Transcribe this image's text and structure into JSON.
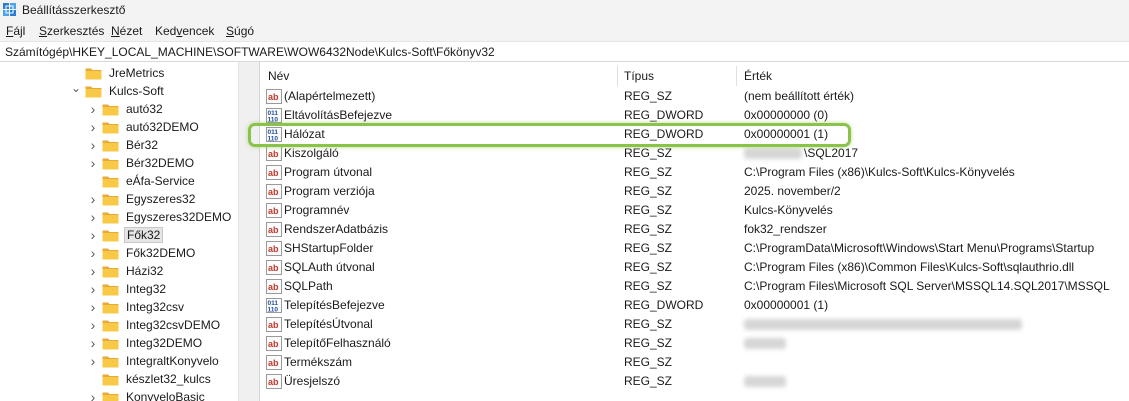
{
  "window": {
    "title": "Beállításszerkesztő"
  },
  "menu": [
    {
      "pre": "",
      "u": "F",
      "post": "ájl"
    },
    {
      "pre": "",
      "u": "S",
      "post": "zerkesztés"
    },
    {
      "pre": "",
      "u": "N",
      "post": "ézet"
    },
    {
      "pre": "Ked",
      "u": "v",
      "post": "encek"
    },
    {
      "pre": "",
      "u": "S",
      "post": "úgó"
    }
  ],
  "address": "Számítógép\\HKEY_LOCAL_MACHINE\\SOFTWARE\\WOW6432Node\\Kulcs-Soft\\Főkönyv32",
  "tree": [
    {
      "label": "JreMetrics",
      "chevron": ""
    },
    {
      "label": "Kulcs-Soft",
      "chevron": "expanded"
    },
    {
      "label": "autó32",
      "chevron": "collapsed"
    },
    {
      "label": "autó32DEMO",
      "chevron": "collapsed"
    },
    {
      "label": "Bér32",
      "chevron": "collapsed"
    },
    {
      "label": "Bér32DEMO",
      "chevron": "collapsed"
    },
    {
      "label": "eÁfa-Service",
      "chevron": ""
    },
    {
      "label": "Egyszeres32",
      "chevron": "collapsed"
    },
    {
      "label": "Egyszeres32DEMO",
      "chevron": "collapsed"
    },
    {
      "label": "Fők32",
      "chevron": "collapsed",
      "selected": true
    },
    {
      "label": "Fők32DEMO",
      "chevron": "collapsed"
    },
    {
      "label": "Házi32",
      "chevron": "collapsed"
    },
    {
      "label": "Integ32",
      "chevron": "collapsed"
    },
    {
      "label": "Integ32csv",
      "chevron": "collapsed"
    },
    {
      "label": "Integ32csvDEMO",
      "chevron": "collapsed"
    },
    {
      "label": "Integ32DEMO",
      "chevron": "collapsed"
    },
    {
      "label": "IntegraltKonyvelo",
      "chevron": "collapsed"
    },
    {
      "label": "készlet32_kulcs",
      "chevron": ""
    },
    {
      "label": "KonyveloBasic",
      "chevron": "collapsed"
    }
  ],
  "columns": {
    "name": "Név",
    "type": "Típus",
    "value": "Érték"
  },
  "rows": [
    {
      "icon": "string",
      "name": "(Alapértelmezett)",
      "type": "REG_SZ",
      "value": "(nem beállított érték)"
    },
    {
      "icon": "binary",
      "name": "EltávolításBefejezve",
      "type": "REG_DWORD",
      "value": "0x00000000 (0)"
    },
    {
      "icon": "binary",
      "name": "Hálózat",
      "type": "REG_DWORD",
      "value": "0x00000001 (1)",
      "highlighted": true
    },
    {
      "icon": "string",
      "name": "Kiszolgáló",
      "type": "REG_SZ",
      "value": "\\SQL2017",
      "blurred_prefix": true
    },
    {
      "icon": "string",
      "name": "Program útvonal",
      "type": "REG_SZ",
      "value": "C:\\Program Files (x86)\\Kulcs-Soft\\Kulcs-Könyvelés"
    },
    {
      "icon": "string",
      "name": "Program verziója",
      "type": "REG_SZ",
      "value": "2025. november/2"
    },
    {
      "icon": "string",
      "name": "Programnév",
      "type": "REG_SZ",
      "value": "Kulcs-Könyvelés"
    },
    {
      "icon": "string",
      "name": "RendszerAdatbázis",
      "type": "REG_SZ",
      "value": "fok32_rendszer"
    },
    {
      "icon": "string",
      "name": "SHStartupFolder",
      "type": "REG_SZ",
      "value": "C:\\ProgramData\\Microsoft\\Windows\\Start Menu\\Programs\\Startup"
    },
    {
      "icon": "string",
      "name": "SQLAuth útvonal",
      "type": "REG_SZ",
      "value": "C:\\Program Files (x86)\\Common Files\\Kulcs-Soft\\sqlauthrio.dll"
    },
    {
      "icon": "string",
      "name": "SQLPath",
      "type": "REG_SZ",
      "value": "C:\\Program Files\\Microsoft SQL Server\\MSSQL14.SQL2017\\MSSQL"
    },
    {
      "icon": "binary",
      "name": "TelepítésBefejezve",
      "type": "REG_DWORD",
      "value": "0x00000001 (1)"
    },
    {
      "icon": "string",
      "name": "TelepítésÚtvonal",
      "type": "REG_SZ",
      "value": "",
      "blurred": "long"
    },
    {
      "icon": "string",
      "name": "TelepítőFelhasználó",
      "type": "REG_SZ",
      "value": "",
      "blurred": "short"
    },
    {
      "icon": "string",
      "name": "Termékszám",
      "type": "REG_SZ",
      "value": ""
    },
    {
      "icon": "string",
      "name": "Üresjelszó",
      "type": "REG_SZ",
      "value": "",
      "blurred": "short"
    }
  ],
  "colors": {
    "highlight": "#8bc34a",
    "string_icon": "#c0392b",
    "binary_icon": "#1f4e9e",
    "folder": "#f5c242"
  }
}
